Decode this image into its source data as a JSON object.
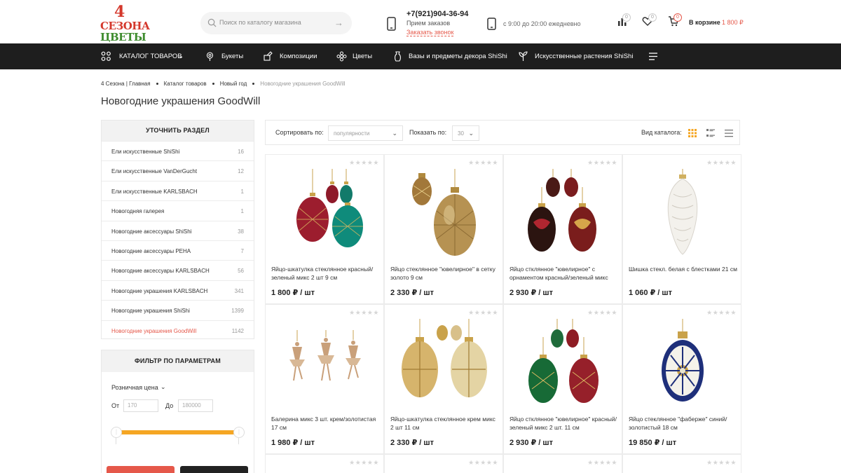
{
  "logo": {
    "line1": "4",
    "line2": "СЕЗОНА",
    "line3": "ЦВЕТЫ"
  },
  "search": {
    "placeholder": "Поиск по каталогу магазина"
  },
  "contact": {
    "phone": "+7(921)904-36-94",
    "desc": "Прием заказов",
    "call": "Заказать звонок",
    "hours": "с 9:00 до 20:00 ежедневно"
  },
  "header_icons": {
    "compare_count": "0",
    "favorites_count": "0",
    "cart_count": "0",
    "cart_label": "В корзине",
    "cart_sum": "1 800 ₽"
  },
  "nav": {
    "catalog": "КАТАЛОГ ТОВАРОВ",
    "items": [
      "Букеты",
      "Композиции",
      "Цветы",
      "Вазы и предметы декора ShiShi",
      "Искусственные растения ShiShi"
    ]
  },
  "breadcrumb": [
    "4 Сезона | Главная",
    "Каталог товаров",
    "Новый год",
    "Новогодние украшения GoodWill"
  ],
  "page_title": "Новогодние украшения GoodWill",
  "sidebar": {
    "title": "УТОЧНИТЬ РАЗДЕЛ",
    "items": [
      {
        "name": "Ели искусственные ShiShi",
        "count": "16"
      },
      {
        "name": "Ели искусственные VanDerGucht",
        "count": "12"
      },
      {
        "name": "Ели искусственные KARLSBACH",
        "count": "1"
      },
      {
        "name": "Новогодняя галерея",
        "count": "1"
      },
      {
        "name": "Новогодние аксессуары ShiShi",
        "count": "38"
      },
      {
        "name": "Новогодние аксессуары PEHA",
        "count": "7"
      },
      {
        "name": "Новогодние аксессуары KARLSBACH",
        "count": "56"
      },
      {
        "name": "Новогодние украшения KARLSBACH",
        "count": "341"
      },
      {
        "name": "Новогодние украшения ShiShi",
        "count": "1399"
      },
      {
        "name": "Новогодние украшения GoodWill",
        "count": "1142"
      }
    ]
  },
  "filter": {
    "title": "ФИЛЬТР ПО ПАРАМЕТРАМ",
    "price_label": "Розничная цена",
    "from_label": "От",
    "from_placeholder": "170",
    "to_label": "До",
    "to_placeholder": "180000"
  },
  "sortbar": {
    "sort_label": "Сортировать по:",
    "sort_value": "популярности",
    "show_label": "Показать по:",
    "show_value": "30",
    "view_label": "Вид каталога:"
  },
  "products": [
    {
      "name": "Яйцо-шкатулка стеклянное красный/зеленый микс 2 шт 9 см",
      "price": "1 800 ₽ / шт"
    },
    {
      "name": "Яйцо стеклянное \"ювелирное\" в сетку золото 9 см",
      "price": "2 330 ₽ / шт"
    },
    {
      "name": "Яйцо стклянное \"ювелирное\" с орнаментом красный/зеленый микс",
      "price": "2 930 ₽ / шт"
    },
    {
      "name": "Шишка стекл. белая с блестками 21 см",
      "price": "1 060 ₽ / шт"
    },
    {
      "name": "Балерина микс 3 шт. крем/золотистая 17 см",
      "price": "1 980 ₽ / шт"
    },
    {
      "name": "Яйцо-шкатулка стеклянное крем микс 2 шт 11 см",
      "price": "2 330 ₽ / шт"
    },
    {
      "name": "Яйцо стклянное \"ювелирное\" красный/зеленый микс 2 шт. 11 см",
      "price": "2 930 ₽ / шт"
    },
    {
      "name": "Яйцо стеклянное \"фаберже\" синий/золотистый 18 см",
      "price": "19 850 ₽ / шт"
    }
  ],
  "colors": {
    "accent": "#e5584a",
    "nav_bg": "#1e1e1e",
    "slider": "#f5a623",
    "logo_red": "#d4382c",
    "logo_green": "#3e8c2e"
  }
}
